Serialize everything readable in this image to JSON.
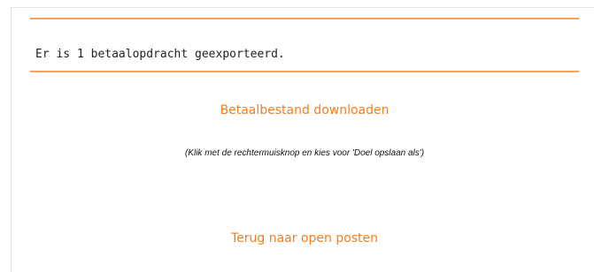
{
  "export": {
    "message": "Er is 1 betaalopdracht geexporteerd.",
    "download_link": "Betaalbestand downloaden",
    "hint": "(Klik met de rechtermuisknop en kies voor 'Doel opslaan als')",
    "back_link": "Terug naar open posten"
  },
  "colors": {
    "accent": "#f07f1e",
    "rule": "#f5a25d",
    "panel_border": "#e2e2e2"
  }
}
